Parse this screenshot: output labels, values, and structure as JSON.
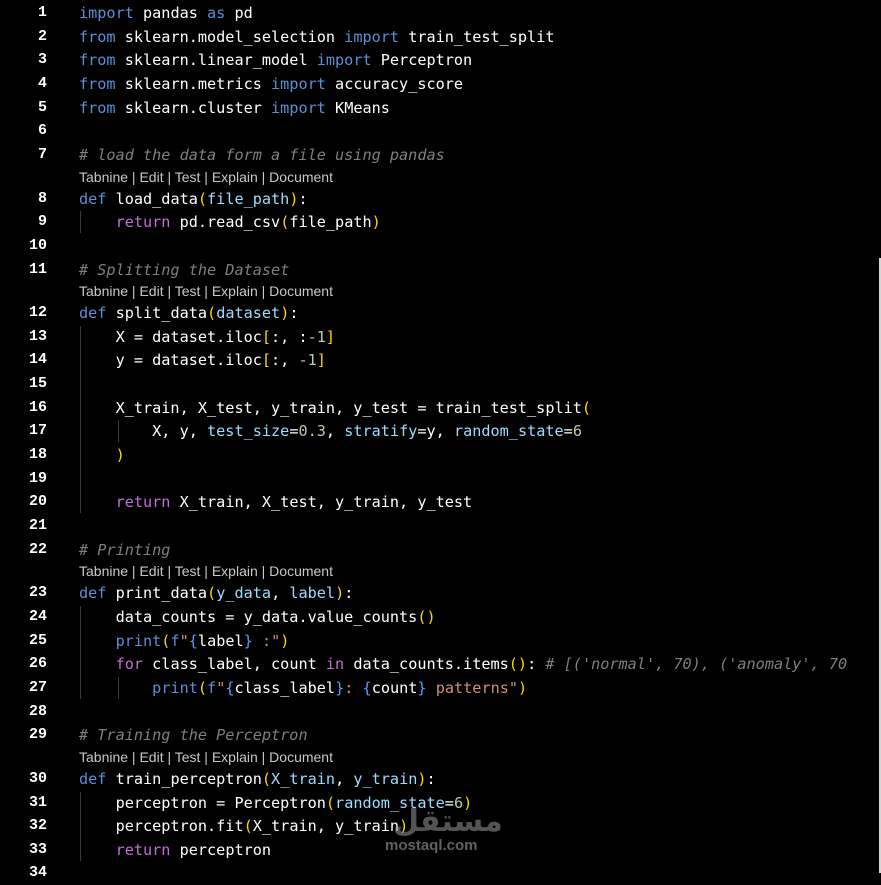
{
  "editor": {
    "lines": [
      {
        "n": "1",
        "tokens": [
          [
            "t-kw",
            "import"
          ],
          [
            "t-id",
            " pandas "
          ],
          [
            "t-kw",
            "as"
          ],
          [
            "t-id",
            " pd"
          ]
        ]
      },
      {
        "n": "2",
        "tokens": [
          [
            "t-kw",
            "from"
          ],
          [
            "t-id",
            " sklearn.model_selection "
          ],
          [
            "t-kw",
            "import"
          ],
          [
            "t-id",
            " train_test_split"
          ]
        ]
      },
      {
        "n": "3",
        "tokens": [
          [
            "t-kw",
            "from"
          ],
          [
            "t-id",
            " sklearn.linear_model "
          ],
          [
            "t-kw",
            "import"
          ],
          [
            "t-id",
            " Perceptron"
          ]
        ]
      },
      {
        "n": "4",
        "tokens": [
          [
            "t-kw",
            "from"
          ],
          [
            "t-id",
            " sklearn.metrics "
          ],
          [
            "t-kw",
            "import"
          ],
          [
            "t-id",
            " accuracy_score"
          ]
        ]
      },
      {
        "n": "5",
        "tokens": [
          [
            "t-kw",
            "from"
          ],
          [
            "t-id",
            " sklearn.cluster "
          ],
          [
            "t-kw",
            "import"
          ],
          [
            "t-id",
            " KMeans"
          ]
        ]
      },
      {
        "n": "6",
        "tokens": []
      },
      {
        "n": "7",
        "tokens": [
          [
            "t-cm",
            "# load the data form a file using pandas"
          ]
        ]
      },
      {
        "n": "",
        "lens": "Tabnine | Edit | Test | Explain | Document"
      },
      {
        "n": "8",
        "tokens": [
          [
            "t-kw",
            "def"
          ],
          [
            "t-fn",
            " load_data"
          ],
          [
            "t-b1",
            "("
          ],
          [
            "t-p",
            "file_path"
          ],
          [
            "t-b1",
            ")"
          ],
          [
            "t-id",
            ":"
          ]
        ]
      },
      {
        "n": "9",
        "tokens": [
          [
            "t-id",
            "    "
          ],
          [
            "t-ctl",
            "return"
          ],
          [
            "t-id",
            " pd.read_csv"
          ],
          [
            "t-b1",
            "("
          ],
          [
            "t-id",
            "file_path"
          ],
          [
            "t-b1",
            ")"
          ]
        ]
      },
      {
        "n": "10",
        "tokens": []
      },
      {
        "n": "11",
        "tokens": [
          [
            "t-cm",
            "# Splitting the Dataset"
          ]
        ]
      },
      {
        "n": "",
        "lens": "Tabnine | Edit | Test | Explain | Document"
      },
      {
        "n": "12",
        "tokens": [
          [
            "t-kw",
            "def"
          ],
          [
            "t-fn",
            " split_data"
          ],
          [
            "t-b1",
            "("
          ],
          [
            "t-p",
            "dataset"
          ],
          [
            "t-b1",
            ")"
          ],
          [
            "t-id",
            ":"
          ]
        ]
      },
      {
        "n": "13",
        "tokens": [
          [
            "t-id",
            "    X = dataset.iloc"
          ],
          [
            "t-b1",
            "["
          ],
          [
            "t-id",
            ":, :"
          ],
          [
            "t-num",
            "-1"
          ],
          [
            "t-b1",
            "]"
          ]
        ]
      },
      {
        "n": "14",
        "tokens": [
          [
            "t-id",
            "    y = dataset.iloc"
          ],
          [
            "t-b1",
            "["
          ],
          [
            "t-id",
            ":, "
          ],
          [
            "t-num",
            "-1"
          ],
          [
            "t-b1",
            "]"
          ]
        ]
      },
      {
        "n": "15",
        "tokens": []
      },
      {
        "n": "16",
        "tokens": [
          [
            "t-id",
            "    X_train, X_test, y_train, y_test = train_test_split"
          ],
          [
            "t-b1",
            "("
          ]
        ]
      },
      {
        "n": "17",
        "tokens": [
          [
            "t-id",
            "        X, y, "
          ],
          [
            "t-kwa",
            "test_size"
          ],
          [
            "t-id",
            "="
          ],
          [
            "t-num",
            "0.3"
          ],
          [
            "t-id",
            ", "
          ],
          [
            "t-kwa",
            "stratify"
          ],
          [
            "t-id",
            "=y, "
          ],
          [
            "t-kwa",
            "random_state"
          ],
          [
            "t-id",
            "="
          ],
          [
            "t-num",
            "6"
          ]
        ]
      },
      {
        "n": "18",
        "tokens": [
          [
            "t-id",
            "    "
          ],
          [
            "t-b1",
            ")"
          ]
        ]
      },
      {
        "n": "19",
        "tokens": []
      },
      {
        "n": "20",
        "tokens": [
          [
            "t-id",
            "    "
          ],
          [
            "t-ctl",
            "return"
          ],
          [
            "t-id",
            " X_train, X_test, y_train, y_test"
          ]
        ]
      },
      {
        "n": "21",
        "tokens": []
      },
      {
        "n": "22",
        "tokens": [
          [
            "t-cm",
            "# Printing"
          ]
        ]
      },
      {
        "n": "",
        "lens": "Tabnine | Edit | Test | Explain | Document"
      },
      {
        "n": "23",
        "tokens": [
          [
            "t-kw",
            "def"
          ],
          [
            "t-fn",
            " print_data"
          ],
          [
            "t-b1",
            "("
          ],
          [
            "t-p",
            "y_data"
          ],
          [
            "t-id",
            ", "
          ],
          [
            "t-p",
            "label"
          ],
          [
            "t-b1",
            ")"
          ],
          [
            "t-id",
            ":"
          ]
        ]
      },
      {
        "n": "24",
        "tokens": [
          [
            "t-id",
            "    data_counts = y_data.value_counts"
          ],
          [
            "t-b1",
            "()"
          ]
        ]
      },
      {
        "n": "25",
        "tokens": [
          [
            "t-id",
            "    "
          ],
          [
            "t-kw",
            "print"
          ],
          [
            "t-b1",
            "("
          ],
          [
            "t-kw",
            "f"
          ],
          [
            "t-str",
            "\""
          ],
          [
            "t-b3",
            "{"
          ],
          [
            "t-id",
            "label"
          ],
          [
            "t-b3",
            "}"
          ],
          [
            "t-str",
            " :\""
          ],
          [
            "t-b1",
            ")"
          ]
        ]
      },
      {
        "n": "26",
        "tokens": [
          [
            "t-id",
            "    "
          ],
          [
            "t-ctl",
            "for"
          ],
          [
            "t-id",
            " class_label, count "
          ],
          [
            "t-ctl",
            "in"
          ],
          [
            "t-id",
            " data_counts.items"
          ],
          [
            "t-b1",
            "()"
          ],
          [
            "t-id",
            ": "
          ],
          [
            "t-cm",
            "# [('normal', 70), ('anomaly', 70"
          ]
        ]
      },
      {
        "n": "27",
        "tokens": [
          [
            "t-id",
            "        "
          ],
          [
            "t-kw",
            "print"
          ],
          [
            "t-b1",
            "("
          ],
          [
            "t-kw",
            "f"
          ],
          [
            "t-str",
            "\""
          ],
          [
            "t-b3",
            "{"
          ],
          [
            "t-id",
            "class_label"
          ],
          [
            "t-b3",
            "}"
          ],
          [
            "t-str",
            ": "
          ],
          [
            "t-b3",
            "{"
          ],
          [
            "t-id",
            "count"
          ],
          [
            "t-b3",
            "}"
          ],
          [
            "t-str",
            " patterns\""
          ],
          [
            "t-b1",
            ")"
          ]
        ]
      },
      {
        "n": "28",
        "tokens": []
      },
      {
        "n": "29",
        "tokens": [
          [
            "t-cm",
            "# Training the Perceptron"
          ]
        ]
      },
      {
        "n": "",
        "lens": "Tabnine | Edit | Test | Explain | Document"
      },
      {
        "n": "30",
        "tokens": [
          [
            "t-kw",
            "def"
          ],
          [
            "t-fn",
            " train_perceptron"
          ],
          [
            "t-b1",
            "("
          ],
          [
            "t-p",
            "X_train"
          ],
          [
            "t-id",
            ", "
          ],
          [
            "t-p",
            "y_train"
          ],
          [
            "t-b1",
            ")"
          ],
          [
            "t-id",
            ":"
          ]
        ]
      },
      {
        "n": "31",
        "tokens": [
          [
            "t-id",
            "    perceptron = Perceptron"
          ],
          [
            "t-b1",
            "("
          ],
          [
            "t-kwa",
            "random_state"
          ],
          [
            "t-id",
            "="
          ],
          [
            "t-num",
            "6"
          ],
          [
            "t-b1",
            ")"
          ]
        ]
      },
      {
        "n": "32",
        "tokens": [
          [
            "t-id",
            "    perceptron.fit"
          ],
          [
            "t-b1",
            "("
          ],
          [
            "t-id",
            "X_train, y_train"
          ],
          [
            "t-b1",
            ")"
          ]
        ]
      },
      {
        "n": "33",
        "tokens": [
          [
            "t-id",
            "    "
          ],
          [
            "t-ctl",
            "return"
          ],
          [
            "t-id",
            " perceptron"
          ]
        ]
      },
      {
        "n": "34",
        "tokens": []
      }
    ]
  },
  "watermark": {
    "mark": "مستقل",
    "text": "mostaql.com"
  }
}
